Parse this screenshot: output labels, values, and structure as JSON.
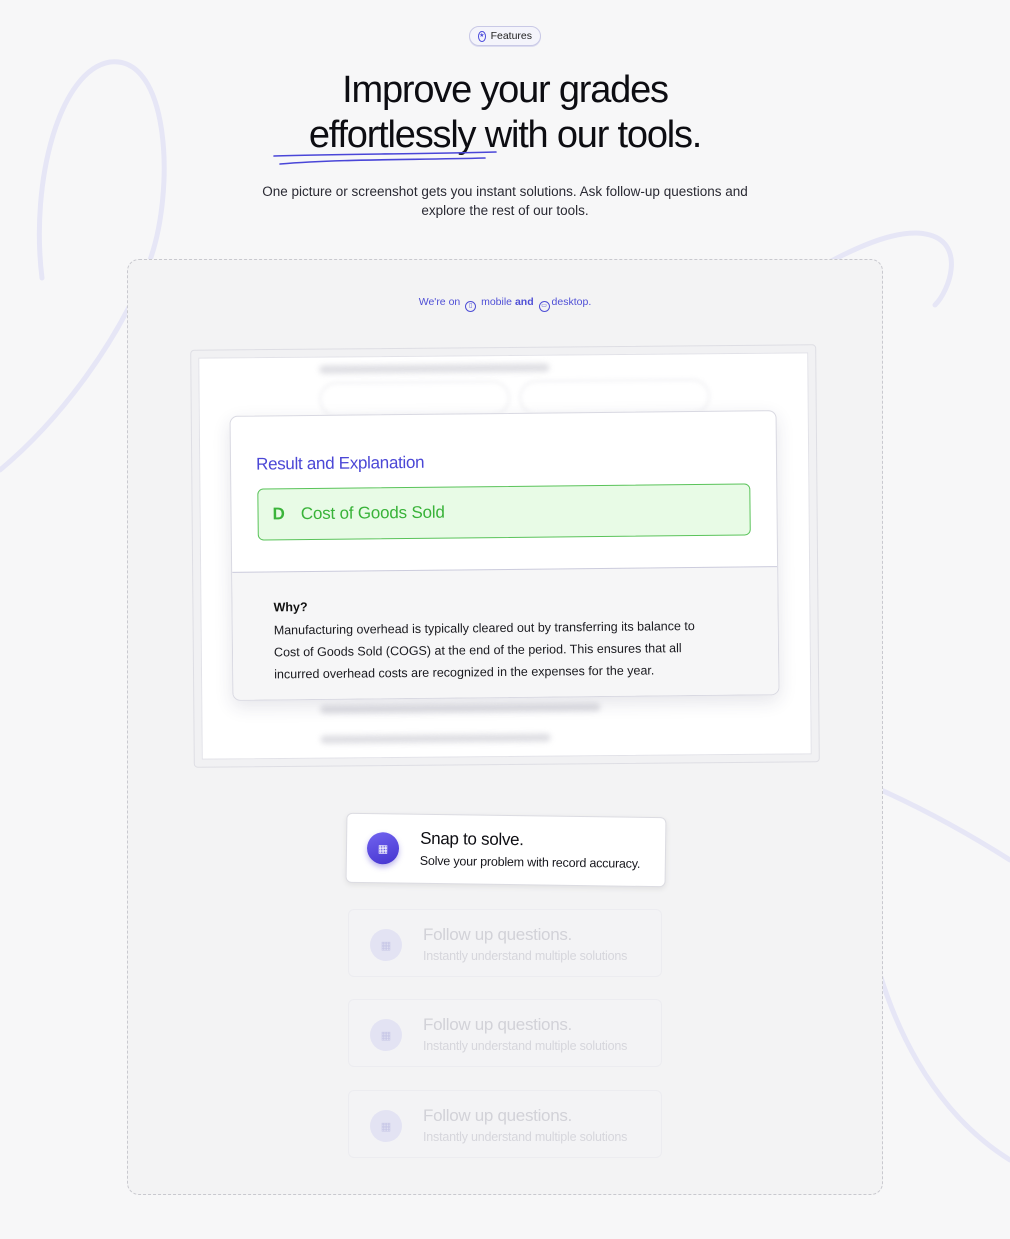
{
  "badge": {
    "label": "Features",
    "icon": "star-icon"
  },
  "hero": {
    "title_line1": "Improve your grades",
    "title_line2": "effortlessly with our tools.",
    "subtitle": "One picture or screenshot gets you instant solutions. Ask follow-up questions and explore the rest of our tools."
  },
  "platforms": {
    "prefix": "We're on",
    "mobile": "mobile",
    "and": "and",
    "desktop": "desktop."
  },
  "result": {
    "title": "Result and Explanation",
    "answer_letter": "D",
    "answer_text": "Cost of Goods Sold",
    "why_title": "Why?",
    "why_body": "Manufacturing overhead is typically cleared out by transferring its balance to Cost of Goods Sold (COGS) at the end of the period. This ensures that all incurred overhead costs are recognized in the expenses for the year."
  },
  "features": [
    {
      "title": "Snap to solve.",
      "description": "Solve your problem with record accuracy.",
      "icon": "grid-icon"
    },
    {
      "title": "Follow up questions.",
      "description": "Instantly understand multiple solutions",
      "icon": "grid-icon"
    },
    {
      "title": "Follow up questions.",
      "description": "Instantly understand multiple solutions",
      "icon": "grid-icon"
    },
    {
      "title": "Follow up questions.",
      "description": "Instantly understand multiple solutions",
      "icon": "grid-icon"
    }
  ],
  "colors": {
    "accent": "#4b47d6",
    "answer_green": "#39b339",
    "answer_bg": "#e8fbe6",
    "background": "#f7f7f8"
  }
}
